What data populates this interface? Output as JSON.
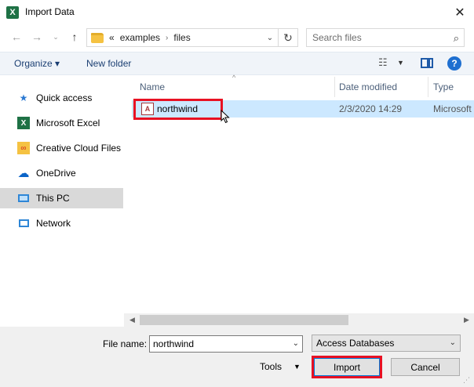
{
  "window": {
    "title": "Import Data",
    "app_icon_letter": "X",
    "close_glyph": "✕"
  },
  "address": {
    "crumbs": [
      "«",
      "examples",
      "files"
    ],
    "separator": "›"
  },
  "search": {
    "placeholder": "Search files"
  },
  "toolbar": {
    "organize_label": "Organize ▾",
    "new_folder_label": "New folder",
    "help_glyph": "?"
  },
  "sidebar": {
    "items": [
      {
        "label": "Quick access"
      },
      {
        "label": "Microsoft Excel"
      },
      {
        "label": "Creative Cloud Files"
      },
      {
        "label": "OneDrive"
      },
      {
        "label": "This PC",
        "selected": true
      },
      {
        "label": "Network"
      }
    ]
  },
  "file_list": {
    "columns": [
      "Name",
      "Date modified",
      "Type"
    ],
    "rows": [
      {
        "name": "northwind",
        "date_modified": "2/3/2020 14:29",
        "type": "Microsoft",
        "icon_letter": "A"
      }
    ]
  },
  "bottom": {
    "file_name_label": "File name:",
    "file_name_value": "northwind",
    "file_type": "Access Databases",
    "tools_label": "Tools",
    "import_label": "Import",
    "cancel_label": "Cancel"
  },
  "colors": {
    "highlight_box": "#e81123",
    "selected_row": "#cce8ff",
    "excel_green": "#1e7145"
  }
}
